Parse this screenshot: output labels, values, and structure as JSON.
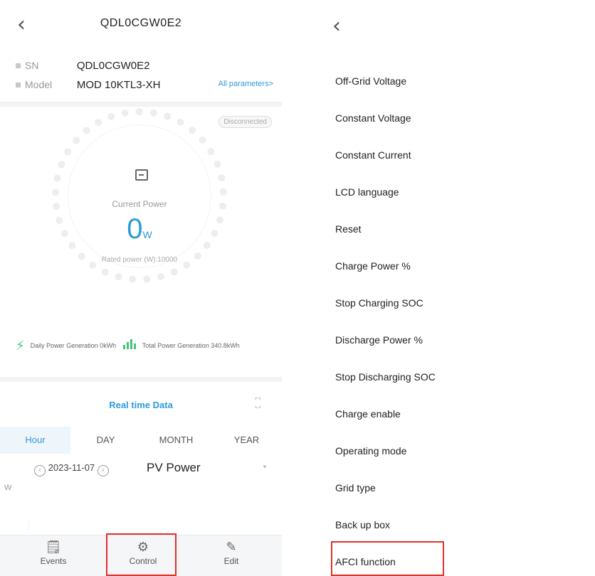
{
  "left": {
    "title": "QDL0CGW0E2",
    "sn_label": "SN",
    "sn_value": "QDL0CGW0E2",
    "model_label": "Model",
    "model_value": "MOD 10KTL3-XH",
    "all_params": "All parameters>",
    "status": "Disconnected",
    "current_power_label": "Current Power",
    "current_power_value": "0",
    "current_power_unit": "W",
    "rated_power": "Rated power (W):10000",
    "daily_gen": "Daily Power Generation 0kWh",
    "total_gen": "Total Power Generation 340.8kWh",
    "realtime_title": "Real time Data",
    "tabs": [
      "Hour",
      "DAY",
      "MONTH",
      "YEAR"
    ],
    "date": "2023-11-07",
    "series_label": "PV Power",
    "axis_unit": "W",
    "nav": [
      {
        "label": "Events",
        "icon": "events-icon"
      },
      {
        "label": "Control",
        "icon": "gear-icon"
      },
      {
        "label": "Edit",
        "icon": "edit-icon"
      }
    ]
  },
  "right": {
    "items": [
      "Off-Grid Voltage",
      "Constant Voltage",
      "Constant Current",
      "LCD language",
      "Reset",
      "Charge Power %",
      "Stop Charging SOC",
      "Discharge Power %",
      "Stop Discharging SOC",
      "Charge enable",
      "Operating mode",
      "Grid type",
      "Back up box",
      "AFCI function"
    ]
  },
  "colors": {
    "accent": "#2e9bd8",
    "highlight": "#e0312b",
    "green": "#42c57a"
  }
}
